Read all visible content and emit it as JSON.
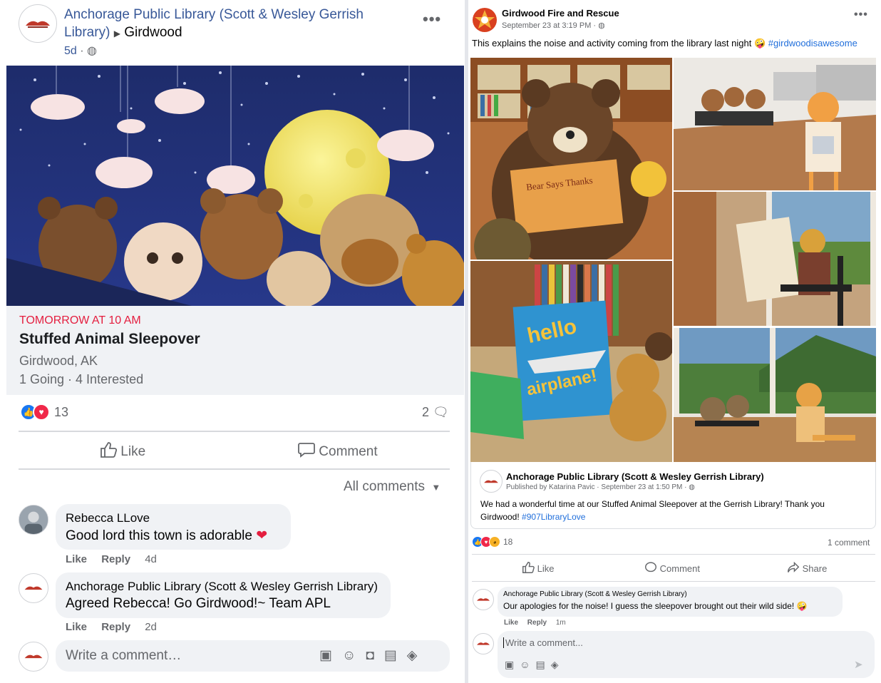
{
  "left": {
    "page_name": "Anchorage Public Library (Scott & Wesley Gerrish Library)",
    "arrow": "▶",
    "location": "Girdwood",
    "age": "5d",
    "event": {
      "when": "TOMORROW AT 10 AM",
      "title": "Stuffed Animal Sleepover",
      "place": "Girdwood, AK",
      "stats": "1 Going · 4 Interested"
    },
    "reaction_count": "13",
    "comment_count": "2",
    "like_label": "Like",
    "comment_label": "Comment",
    "sort_label": "All comments",
    "comments": [
      {
        "author": "Rebecca LLove",
        "text": "Good lord this town is adorable",
        "like": "Like",
        "reply": "Reply",
        "time": "4d"
      },
      {
        "author": "Anchorage Public Library (Scott & Wesley Gerrish Library)",
        "text": "Agreed Rebecca! Go Girdwood!~ Team APL",
        "like": "Like",
        "reply": "Reply",
        "time": "2d"
      }
    ],
    "write_placeholder": "Write a comment…"
  },
  "right": {
    "page_name": "Girdwood Fire and Rescue",
    "date": "September 23 at 3:19 PM ·",
    "caption": "This explains the noise and activity coming from the library last night",
    "hashtag": "#girdwoodisawesome",
    "book1": "Bear Says Thanks",
    "book2_line1": "hello",
    "book2_line2": "airplane!",
    "shared": {
      "page_name": "Anchorage Public Library (Scott & Wesley Gerrish Library)",
      "meta": "Published by Katarina Pavic · September 23 at 1:50 PM ·",
      "text": "We had a wonderful time at our Stuffed Animal Sleepover at the Gerrish Library! Thank you Girdwood!",
      "hashtag": "#907LibraryLove"
    },
    "reaction_count": "18",
    "comment_count": "1 comment",
    "like_label": "Like",
    "comment_label": "Comment",
    "share_label": "Share",
    "comment": {
      "author": "Anchorage Public Library (Scott & Wesley Gerrish Library)",
      "text": "Our apologies for the noise! I guess the sleepover brought out their wild side!",
      "like": "Like",
      "reply": "Reply",
      "time": "1m"
    },
    "write_placeholder": "Write a comment..."
  },
  "colors": {
    "link": "#385898",
    "event_red": "#e41e3f",
    "like_blue": "#1877f2",
    "love_red": "#f02849"
  }
}
